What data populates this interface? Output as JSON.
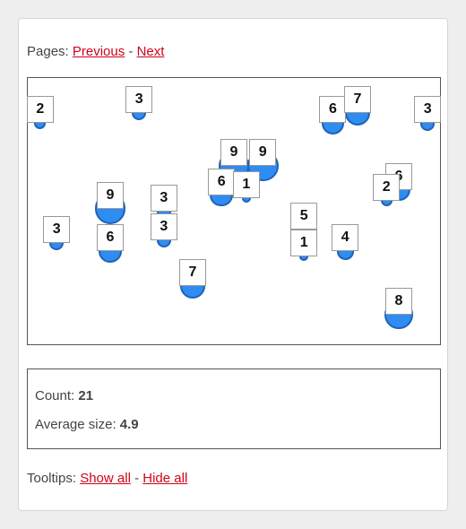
{
  "pages": {
    "label": "Pages: ",
    "previous": "Previous",
    "separator": " - ",
    "next": "Next"
  },
  "tooltips": {
    "label": "Tooltips: ",
    "show_all": "Show all",
    "separator": " - ",
    "hide_all": "Hide all"
  },
  "stats": {
    "count_label": "Count: ",
    "count": "21",
    "avg_label": "Average size: ",
    "avg": "4.9"
  },
  "colors": {
    "dot_fill": "#2f8cf2",
    "dot_stroke": "#1f63b8",
    "link": "#d0021b"
  },
  "chart_data": {
    "type": "scatter",
    "title": "",
    "points": [
      {
        "x": 0.03,
        "y": 0.83,
        "size": 2
      },
      {
        "x": 0.27,
        "y": 0.87,
        "size": 3
      },
      {
        "x": 0.74,
        "y": 0.83,
        "size": 6
      },
      {
        "x": 0.8,
        "y": 0.87,
        "size": 7
      },
      {
        "x": 0.97,
        "y": 0.83,
        "size": 3
      },
      {
        "x": 0.5,
        "y": 0.67,
        "size": 9
      },
      {
        "x": 0.57,
        "y": 0.67,
        "size": 9
      },
      {
        "x": 0.47,
        "y": 0.56,
        "size": 6
      },
      {
        "x": 0.53,
        "y": 0.55,
        "size": 1
      },
      {
        "x": 0.2,
        "y": 0.51,
        "size": 9
      },
      {
        "x": 0.33,
        "y": 0.5,
        "size": 3
      },
      {
        "x": 0.33,
        "y": 0.39,
        "size": 3
      },
      {
        "x": 0.2,
        "y": 0.35,
        "size": 6
      },
      {
        "x": 0.07,
        "y": 0.38,
        "size": 3
      },
      {
        "x": 0.67,
        "y": 0.43,
        "size": 5
      },
      {
        "x": 0.67,
        "y": 0.33,
        "size": 1
      },
      {
        "x": 0.77,
        "y": 0.35,
        "size": 4
      },
      {
        "x": 0.9,
        "y": 0.58,
        "size": 6
      },
      {
        "x": 0.87,
        "y": 0.54,
        "size": 2
      },
      {
        "x": 0.4,
        "y": 0.22,
        "size": 7
      },
      {
        "x": 0.9,
        "y": 0.11,
        "size": 8
      }
    ]
  }
}
